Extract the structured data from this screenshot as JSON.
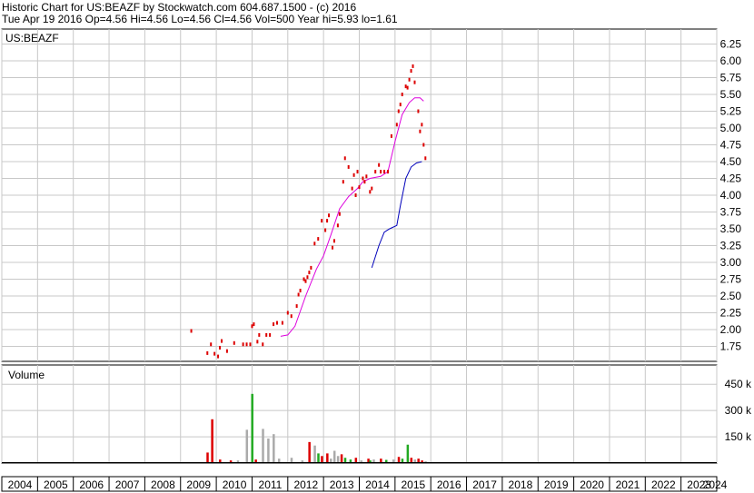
{
  "header": {
    "line1": "Historic Chart for US:BEAZF by Stockwatch.com 604.687.1500 - (c) 2016",
    "line2": "Tue Apr 19 2016   Op=4.56  Hi=4.56  Lo=4.56  Cl=4.56  Vol=500   Year hi=5.93  lo=1.61"
  },
  "colors": {
    "price": "#dd0000",
    "price_dark": "#000000",
    "ma_short": "#dd00dd",
    "ma_long": "#0000bb",
    "vol_red": "#dd0000",
    "vol_green": "#22aa22",
    "vol_gray": "#aaaaaa",
    "grid": "#c8c8c8"
  },
  "chart_data": [
    {
      "type": "scatter",
      "title": "US:BEAZF",
      "y_ticks": [
        "6.25",
        "6.00",
        "5.75",
        "5.50",
        "5.25",
        "5.00",
        "4.75",
        "4.50",
        "4.25",
        "4.00",
        "3.75",
        "3.50",
        "3.25",
        "3.00",
        "2.75",
        "2.50",
        "2.25",
        "2.00",
        "1.75"
      ],
      "ylim": [
        1.5,
        6.4
      ],
      "xlim": [
        2004,
        2024
      ],
      "grid": true,
      "series": [
        {
          "values": [
            [
              2009.3,
              1.98
            ],
            [
              2009.75,
              1.65
            ],
            [
              2009.85,
              1.78
            ],
            [
              2009.95,
              1.64
            ],
            [
              2010.05,
              1.6
            ],
            [
              2010.1,
              1.73
            ],
            [
              2010.15,
              1.83
            ],
            [
              2010.3,
              1.68
            ],
            [
              2010.5,
              1.8
            ],
            [
              2010.75,
              1.78
            ],
            [
              2010.85,
              1.78
            ],
            [
              2010.95,
              1.78
            ],
            [
              2011.0,
              2.05
            ],
            [
              2011.05,
              2.08
            ],
            [
              2011.15,
              1.82
            ],
            [
              2011.2,
              1.92
            ],
            [
              2011.3,
              1.78
            ],
            [
              2011.4,
              1.92
            ],
            [
              2011.5,
              1.92
            ],
            [
              2011.6,
              2.08
            ],
            [
              2011.7,
              2.1
            ],
            [
              2011.85,
              2.1
            ],
            [
              2012.0,
              2.25
            ],
            [
              2012.1,
              2.2
            ],
            [
              2012.25,
              2.35
            ],
            [
              2012.3,
              2.52
            ],
            [
              2012.35,
              2.58
            ],
            [
              2012.45,
              2.75
            ],
            [
              2012.5,
              2.72
            ],
            [
              2012.55,
              2.78
            ],
            [
              2012.6,
              2.85
            ],
            [
              2012.65,
              2.92
            ],
            [
              2012.75,
              3.28
            ],
            [
              2012.85,
              3.35
            ],
            [
              2012.95,
              3.62
            ],
            [
              2013.05,
              3.48
            ],
            [
              2013.1,
              3.62
            ],
            [
              2013.15,
              3.7
            ],
            [
              2013.25,
              3.22
            ],
            [
              2013.3,
              3.32
            ],
            [
              2013.4,
              3.55
            ],
            [
              2013.45,
              3.72
            ],
            [
              2013.55,
              4.2
            ],
            [
              2013.6,
              4.55
            ],
            [
              2013.7,
              4.42
            ],
            [
              2013.8,
              4.1
            ],
            [
              2013.85,
              4.3
            ],
            [
              2013.9,
              4.0
            ],
            [
              2013.95,
              4.35
            ],
            [
              2014.0,
              4.12
            ],
            [
              2014.1,
              4.25
            ],
            [
              2014.15,
              4.2
            ],
            [
              2014.2,
              4.28
            ],
            [
              2014.3,
              4.05
            ],
            [
              2014.35,
              4.1
            ],
            [
              2014.45,
              4.35
            ],
            [
              2014.55,
              4.45
            ],
            [
              2014.6,
              4.35
            ],
            [
              2014.7,
              4.35
            ],
            [
              2014.8,
              4.35
            ],
            [
              2014.9,
              4.88
            ],
            [
              2015.05,
              5.05
            ],
            [
              2015.1,
              5.25
            ],
            [
              2015.15,
              5.35
            ],
            [
              2015.2,
              5.5
            ],
            [
              2015.3,
              5.62
            ],
            [
              2015.35,
              5.6
            ],
            [
              2015.4,
              5.72
            ],
            [
              2015.45,
              5.85
            ],
            [
              2015.5,
              5.92
            ],
            [
              2015.55,
              5.68
            ],
            [
              2015.65,
              5.25
            ],
            [
              2015.7,
              4.95
            ],
            [
              2015.75,
              5.05
            ],
            [
              2015.8,
              4.75
            ],
            [
              2015.85,
              4.55
            ]
          ]
        },
        {
          "values": [
            [
              2011.8,
              1.9
            ],
            [
              2012.0,
              1.92
            ],
            [
              2012.2,
              2.05
            ],
            [
              2012.5,
              2.5
            ],
            [
              2012.8,
              2.9
            ],
            [
              2013.0,
              3.1
            ],
            [
              2013.2,
              3.4
            ],
            [
              2013.45,
              3.8
            ],
            [
              2013.7,
              3.98
            ],
            [
              2013.95,
              4.1
            ],
            [
              2014.1,
              4.2
            ],
            [
              2014.3,
              4.25
            ],
            [
              2014.6,
              4.28
            ],
            [
              2014.8,
              4.35
            ],
            [
              2015.0,
              4.8
            ],
            [
              2015.2,
              5.2
            ],
            [
              2015.4,
              5.38
            ],
            [
              2015.55,
              5.45
            ],
            [
              2015.7,
              5.45
            ],
            [
              2015.8,
              5.4
            ]
          ]
        },
        {
          "values": [
            [
              2014.35,
              2.92
            ],
            [
              2014.55,
              3.25
            ],
            [
              2014.7,
              3.45
            ],
            [
              2014.85,
              3.5
            ],
            [
              2015.05,
              3.55
            ],
            [
              2015.15,
              3.85
            ],
            [
              2015.3,
              4.25
            ],
            [
              2015.45,
              4.42
            ],
            [
              2015.6,
              4.48
            ],
            [
              2015.75,
              4.5
            ]
          ]
        }
      ]
    },
    {
      "type": "bar",
      "title": "Volume",
      "y_ticks": [
        "450 k",
        "300 k",
        "150 k"
      ],
      "ylim": [
        0,
        560
      ],
      "xlabels": [
        "2004",
        "2005",
        "2006",
        "2007",
        "2008",
        "2009",
        "2010",
        "2011",
        "2012",
        "2013",
        "2014",
        "2015",
        "2016",
        "2017",
        "2018",
        "2019",
        "2020",
        "2021",
        "2022",
        "2023",
        "2024"
      ],
      "bars": [
        [
          2009.75,
          60,
          "red"
        ],
        [
          2009.88,
          250,
          "red"
        ],
        [
          2010.1,
          20,
          "red"
        ],
        [
          2010.4,
          15,
          "red"
        ],
        [
          2010.6,
          15,
          "gray"
        ],
        [
          2010.85,
          190,
          "gray"
        ],
        [
          2011.0,
          395,
          "green"
        ],
        [
          2011.1,
          20,
          "red"
        ],
        [
          2011.3,
          195,
          "gray"
        ],
        [
          2011.45,
          140,
          "gray"
        ],
        [
          2011.6,
          165,
          "gray"
        ],
        [
          2011.75,
          25,
          "gray"
        ],
        [
          2012.1,
          30,
          "gray"
        ],
        [
          2012.4,
          15,
          "gray"
        ],
        [
          2012.6,
          120,
          "red"
        ],
        [
          2012.75,
          100,
          "gray"
        ],
        [
          2012.85,
          55,
          "green"
        ],
        [
          2012.95,
          40,
          "red"
        ],
        [
          2013.1,
          55,
          "red"
        ],
        [
          2013.2,
          25,
          "gray"
        ],
        [
          2013.3,
          70,
          "gray"
        ],
        [
          2013.4,
          40,
          "gray"
        ],
        [
          2013.5,
          50,
          "red"
        ],
        [
          2013.6,
          30,
          "green"
        ],
        [
          2013.75,
          20,
          "green"
        ],
        [
          2013.9,
          30,
          "red"
        ],
        [
          2014.05,
          15,
          "gray"
        ],
        [
          2014.25,
          25,
          "red"
        ],
        [
          2014.3,
          15,
          "green"
        ],
        [
          2014.4,
          20,
          "gray"
        ],
        [
          2014.6,
          25,
          "red"
        ],
        [
          2014.75,
          18,
          "green"
        ],
        [
          2014.95,
          20,
          "gray"
        ],
        [
          2015.1,
          35,
          "red"
        ],
        [
          2015.2,
          25,
          "green"
        ],
        [
          2015.35,
          105,
          "green"
        ],
        [
          2015.45,
          30,
          "red"
        ],
        [
          2015.55,
          20,
          "gray"
        ],
        [
          2015.65,
          25,
          "red"
        ],
        [
          2015.75,
          15,
          "red"
        ],
        [
          2015.85,
          10,
          "gray"
        ]
      ]
    }
  ]
}
